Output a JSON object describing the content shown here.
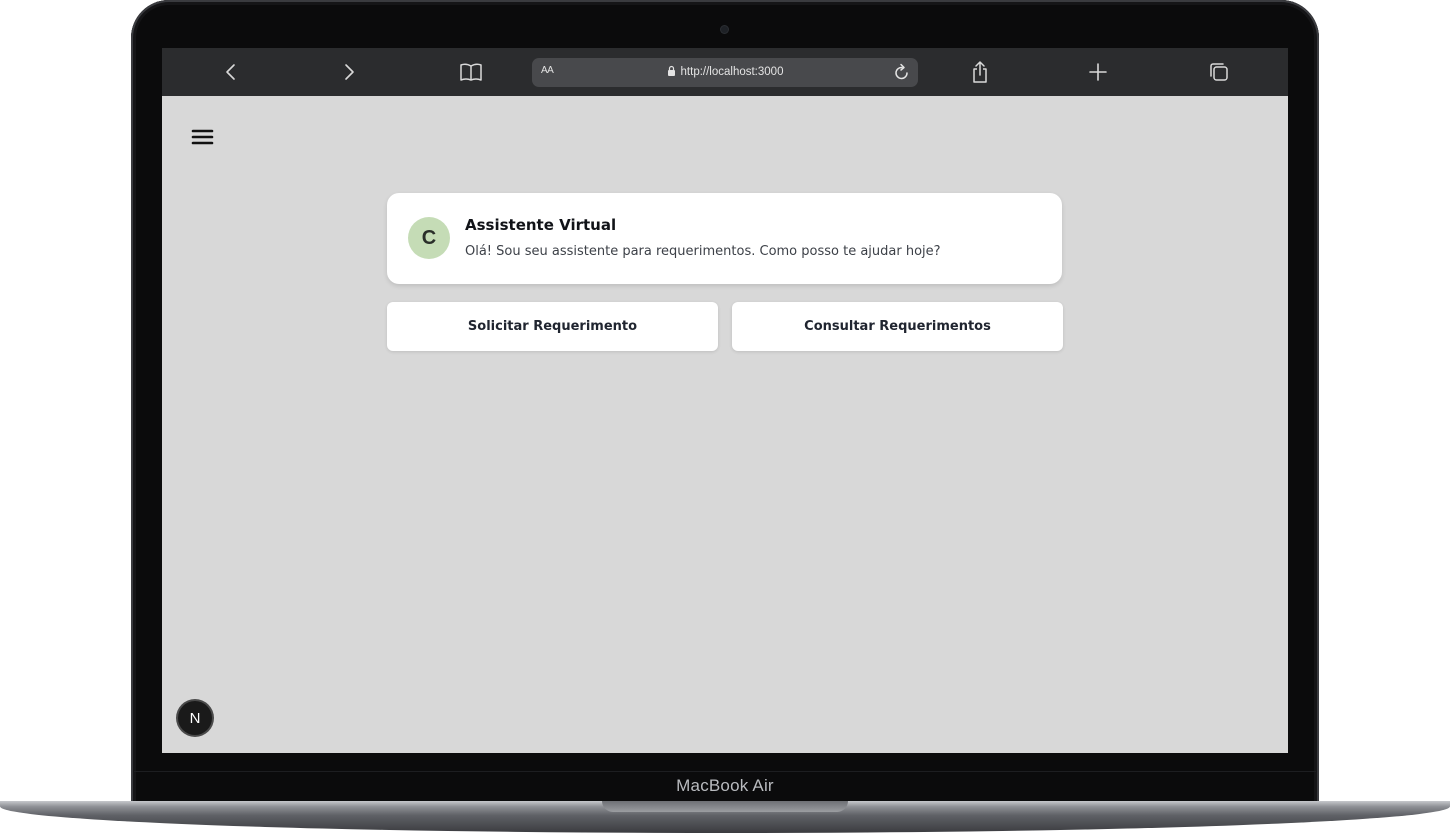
{
  "device": {
    "label": "MacBook Air"
  },
  "browser": {
    "back_icon": "chevron-left-icon",
    "forward_icon": "chevron-right-icon",
    "bookmarks_icon": "book-icon",
    "reader_label": "AA",
    "url": "http://localhost:3000",
    "reload_icon": "reload-icon",
    "share_icon": "share-icon",
    "new_tab_icon": "plus-icon",
    "tabs_icon": "tabs-icon",
    "colors": {
      "bar": "#2b2c2e",
      "address": "#48494c"
    }
  },
  "page": {
    "menu_icon": "hamburger-menu-icon",
    "background": "#d8d8d8",
    "assistant": {
      "avatar_initial": "C",
      "avatar_color": "#c5dcb6",
      "title": "Assistente Virtual",
      "message": "Olá! Sou seu assistente para requerimentos. Como posso te ajudar hoje?"
    },
    "actions": [
      {
        "label": "Solicitar Requerimento"
      },
      {
        "label": "Consultar Requerimentos"
      }
    ],
    "dev_badge": {
      "label": "N",
      "icon": "nextjs-icon"
    }
  }
}
